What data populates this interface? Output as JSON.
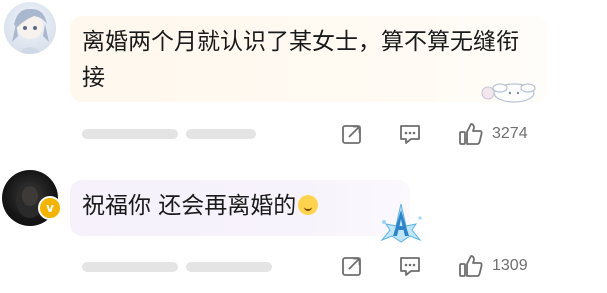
{
  "colors": {
    "bubble_warm": "#fff8ee",
    "bubble_lilac": "#f6f1fb",
    "icon_gray": "#6f6f6f",
    "text_dark": "#1a1a1a",
    "badge_gold": "#f3b400"
  },
  "comments": [
    {
      "avatar_icon": "anime-avatar",
      "text": "离婚两个月就认识了某女士，算不算无缝衔接",
      "decoration_icon": "cinnamoroll-sticker",
      "actions": {
        "share_icon": "share-icon",
        "reply_icon": "comment-icon",
        "like_icon": "thumbs-up-icon",
        "likes": "3274"
      }
    },
    {
      "avatar_icon": "dark-avatar",
      "badge_icon": "verified-v-icon",
      "badge_text": "v",
      "text": "祝福你 还会再离婚的",
      "emoji_icon": "smile-emoji",
      "decoration_icon": "ice-crystal-a-sticker",
      "actions": {
        "share_icon": "share-icon",
        "reply_icon": "comment-icon",
        "like_icon": "thumbs-up-icon",
        "likes": "1309"
      }
    }
  ]
}
